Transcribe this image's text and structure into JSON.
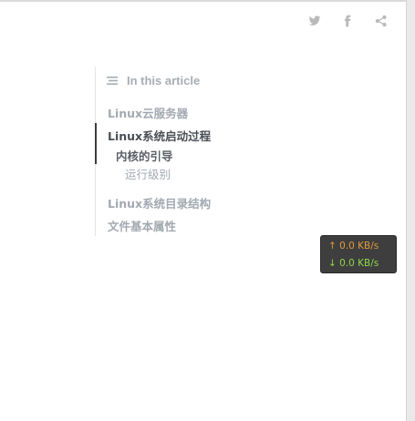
{
  "share": {
    "icons": [
      "twitter-icon",
      "facebook-icon",
      "share-icon"
    ],
    "color": "#b9b9b9"
  },
  "toc": {
    "header": "In this article",
    "items": [
      {
        "label": "Linux云服务器",
        "state": "muted"
      },
      {
        "label": "Linux系统启动过程",
        "state": "active"
      },
      {
        "label": "内核的引导",
        "state": "sub"
      },
      {
        "label": "运行级别",
        "state": "subsub"
      },
      {
        "label": "Linux系统目录结构",
        "state": "muted"
      },
      {
        "label": "文件基本属性",
        "state": "muted"
      }
    ]
  },
  "network": {
    "upload": "↑ 0.0 KB/s",
    "download": "↓ 0.0 KB/s",
    "upload_color": "#e39a3a",
    "download_color": "#8cd64a"
  }
}
